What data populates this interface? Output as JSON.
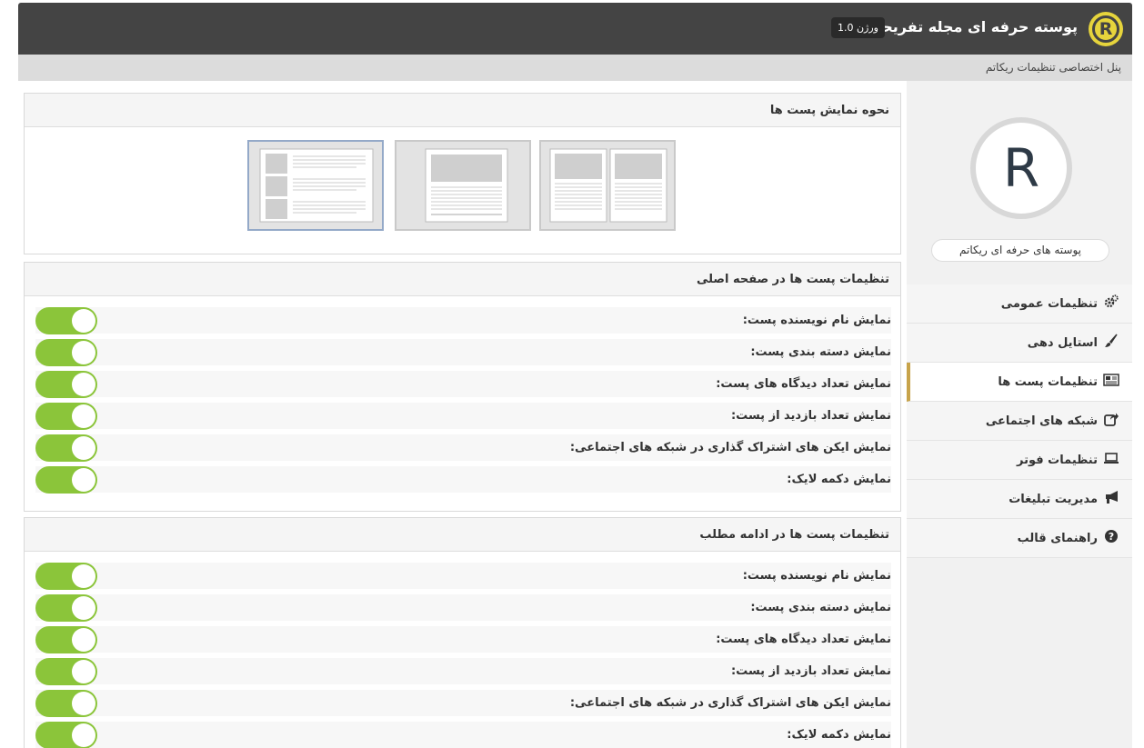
{
  "header": {
    "logo_letter": "R",
    "title": "پوسته حرفه ای مجله تفریحی",
    "version": "ورژن 1.0"
  },
  "subheader": {
    "text": "پنل اختصاصی تنظیمات ریکاتم"
  },
  "sidebar": {
    "avatar_letter": "R",
    "profile_name": "پوسته های حرفه ای ریکاتم",
    "items": [
      {
        "label": "تنظیمات عمومی",
        "icon": "gears-icon",
        "active": false
      },
      {
        "label": "استایل دهی",
        "icon": "brush-icon",
        "active": false
      },
      {
        "label": "تنظیمات پست ها",
        "icon": "newspaper-icon",
        "active": true
      },
      {
        "label": "شبکه های اجتماعی",
        "icon": "share-icon",
        "active": false
      },
      {
        "label": "تنظیمات فوتر",
        "icon": "laptop-icon",
        "active": false
      },
      {
        "label": "مدیریت تبلیغات",
        "icon": "bullhorn-icon",
        "active": false
      },
      {
        "label": "راهنمای قالب",
        "icon": "question-circle-icon",
        "active": false
      }
    ]
  },
  "layout_panel": {
    "title": "نحوه نمایش پست ها",
    "options": [
      "two-column",
      "full-width",
      "list"
    ],
    "selected": "list"
  },
  "home_settings": {
    "title": "تنظیمات پست ها در صفحه اصلی",
    "rows": [
      {
        "label": "نمایش نام نویسنده پست:",
        "enabled": true
      },
      {
        "label": "نمایش دسته بندی پست:",
        "enabled": true
      },
      {
        "label": "نمایش تعداد دیدگاه های پست:",
        "enabled": true
      },
      {
        "label": "نمایش تعداد بازدید از پست:",
        "enabled": true
      },
      {
        "label": "نمایش ایکن های اشتراک گذاری در شبکه های اجتماعی:",
        "enabled": true
      },
      {
        "label": "نمایش دکمه لایک:",
        "enabled": true
      }
    ]
  },
  "single_settings": {
    "title": "تنظیمات پست ها در ادامه مطلب",
    "rows": [
      {
        "label": "نمایش نام نویسنده پست:",
        "enabled": true
      },
      {
        "label": "نمایش دسته بندی پست:",
        "enabled": true
      },
      {
        "label": "نمایش تعداد دیدگاه های پست:",
        "enabled": true
      },
      {
        "label": "نمایش تعداد بازدید از پست:",
        "enabled": true
      },
      {
        "label": "نمایش ایکن های اشتراک گذاری در شبکه های اجتماعی:",
        "enabled": true
      },
      {
        "label": "نمایش دکمه لایک:",
        "enabled": true
      }
    ]
  },
  "colors": {
    "header_bg": "#444444",
    "logo": "#e6d43c",
    "toggle_on": "#8bc53a",
    "active_accent": "#c7a34a"
  }
}
